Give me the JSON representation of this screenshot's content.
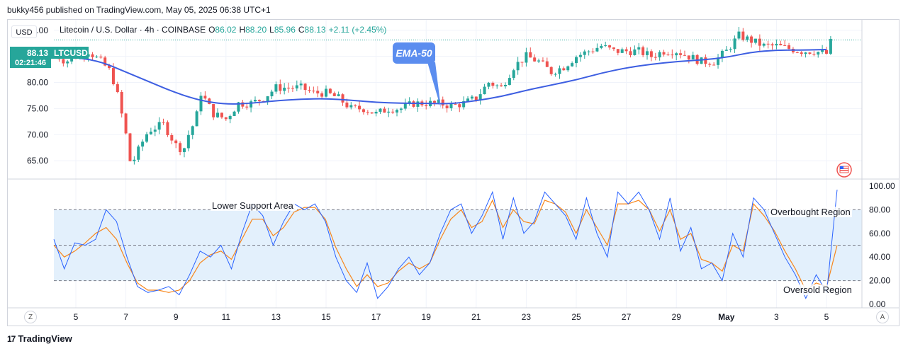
{
  "byline": "bukky456 published on TradingView.com, May 05, 2025 06:38 UTC+1",
  "footer_brand": "TradingView",
  "currency_button": "USD",
  "legend": {
    "symbol": "Litecoin / U.S. Dollar · 4h · COINBASE",
    "open_label": "O",
    "open": "86.02",
    "high_label": "H",
    "high": "88.20",
    "low_label": "L",
    "low": "85.96",
    "close_label": "C",
    "close": "88.13",
    "change": "+2.11 (+2.45%)"
  },
  "price_tag": {
    "price": "88.13",
    "ticker": "LTCUSD",
    "countdown": "02:21:46"
  },
  "ema_callout": "EMA-50",
  "annotations": {
    "lower_support": "Lower Support Area",
    "overbought": "Overbought Region",
    "oversold": "Oversold Region"
  },
  "corner_buttons": {
    "left": "Z",
    "right": "A"
  },
  "colors": {
    "up": "#26a69a",
    "down": "#ef5350",
    "ema": "#3d5ee1",
    "stoch_k": "#2962ff",
    "stoch_d": "#f7861c",
    "band": "#e3f0fc",
    "accent": "#26a69a"
  },
  "chart_data": [
    {
      "type": "candlestick",
      "title": "Litecoin / U.S. Dollar · 4h · COINBASE",
      "x_ticks": [
        "5",
        "7",
        "9",
        "11",
        "13",
        "15",
        "17",
        "19",
        "21",
        "23",
        "25",
        "27",
        "29",
        "May",
        "3",
        "5"
      ],
      "y_ticks": [
        "65.00",
        "70.00",
        "75.00",
        "80.00",
        "85.00",
        "90.00"
      ],
      "ylim": [
        61.5,
        92
      ],
      "last_price": 88.13,
      "close_path": [
        {
          "x": "Apr 4",
          "close": 86
        },
        {
          "x": "Apr 4.6",
          "close": 84
        },
        {
          "x": "Apr 5",
          "close": 85
        },
        {
          "x": "Apr 5.5",
          "close": 86
        },
        {
          "x": "Apr 6",
          "close": 84
        },
        {
          "x": "Apr 6.4",
          "close": 82
        },
        {
          "x": "Apr 6.7",
          "close": 77
        },
        {
          "x": "Apr 7",
          "close": 70
        },
        {
          "x": "Apr 7.2",
          "close": 64
        },
        {
          "x": "Apr 7.5",
          "close": 67
        },
        {
          "x": "Apr 7.8",
          "close": 70
        },
        {
          "x": "Apr 8",
          "close": 71
        },
        {
          "x": "Apr 8.5",
          "close": 72
        },
        {
          "x": "Apr 9",
          "close": 68
        },
        {
          "x": "Apr 9.3",
          "close": 67
        },
        {
          "x": "Apr 9.5",
          "close": 70
        },
        {
          "x": "Apr 9.8",
          "close": 73
        },
        {
          "x": "Apr 10",
          "close": 78
        },
        {
          "x": "Apr 10.5",
          "close": 74
        },
        {
          "x": "Apr 11",
          "close": 73
        },
        {
          "x": "Apr 11.5",
          "close": 76
        },
        {
          "x": "Apr 12",
          "close": 76
        },
        {
          "x": "Apr 12.5",
          "close": 77
        },
        {
          "x": "Apr 13",
          "close": 79
        },
        {
          "x": "Apr 13.5",
          "close": 79
        },
        {
          "x": "Apr 14",
          "close": 79
        },
        {
          "x": "Apr 14.5",
          "close": 78
        },
        {
          "x": "Apr 15",
          "close": 78
        },
        {
          "x": "Apr 15.5",
          "close": 77
        },
        {
          "x": "Apr 16",
          "close": 75
        },
        {
          "x": "Apr 16.5",
          "close": 75
        },
        {
          "x": "Apr 17",
          "close": 74
        },
        {
          "x": "Apr 17.5",
          "close": 75
        },
        {
          "x": "Apr 18",
          "close": 75
        },
        {
          "x": "Apr 18.5",
          "close": 76
        },
        {
          "x": "Apr 19",
          "close": 76
        },
        {
          "x": "Apr 19.5",
          "close": 76
        },
        {
          "x": "Apr 20",
          "close": 75.5
        },
        {
          "x": "Apr 20.5",
          "close": 76
        },
        {
          "x": "Apr 21",
          "close": 77
        },
        {
          "x": "Apr 21.5",
          "close": 80
        },
        {
          "x": "Apr 22",
          "close": 79
        },
        {
          "x": "Apr 22.5",
          "close": 83
        },
        {
          "x": "Apr 23",
          "close": 85
        },
        {
          "x": "Apr 23.5",
          "close": 84
        },
        {
          "x": "Apr 24",
          "close": 82
        },
        {
          "x": "Apr 24.5",
          "close": 83
        },
        {
          "x": "Apr 25",
          "close": 85
        },
        {
          "x": "Apr 25.5",
          "close": 86
        },
        {
          "x": "Apr 26",
          "close": 87
        },
        {
          "x": "Apr 26.5",
          "close": 86
        },
        {
          "x": "Apr 27",
          "close": 86
        },
        {
          "x": "Apr 27.5",
          "close": 86
        },
        {
          "x": "Apr 28",
          "close": 85
        },
        {
          "x": "Apr 28.5",
          "close": 86
        },
        {
          "x": "Apr 29",
          "close": 86
        },
        {
          "x": "Apr 29.5",
          "close": 85
        },
        {
          "x": "Apr 30",
          "close": 84
        },
        {
          "x": "Apr 30.5",
          "close": 84
        },
        {
          "x": "May 1",
          "close": 86
        },
        {
          "x": "May 1.5",
          "close": 89
        },
        {
          "x": "May 2",
          "close": 88
        },
        {
          "x": "May 2.5",
          "close": 87
        },
        {
          "x": "May 3",
          "close": 87
        },
        {
          "x": "May 3.5",
          "close": 86.5
        },
        {
          "x": "May 4",
          "close": 86
        },
        {
          "x": "May 4.5",
          "close": 86
        },
        {
          "x": "May 5",
          "close": 85.5
        },
        {
          "x": "May 5.2",
          "close": 88.13
        }
      ],
      "ema_50": [
        {
          "x": "Apr 4",
          "value": 85
        },
        {
          "x": "Apr 5",
          "value": 84.8
        },
        {
          "x": "Apr 6",
          "value": 84
        },
        {
          "x": "Apr 7",
          "value": 82
        },
        {
          "x": "Apr 8",
          "value": 80
        },
        {
          "x": "Apr 9",
          "value": 78
        },
        {
          "x": "Apr 10",
          "value": 76.5
        },
        {
          "x": "Apr 11",
          "value": 75.8
        },
        {
          "x": "Apr 12",
          "value": 76
        },
        {
          "x": "Apr 13",
          "value": 76.5
        },
        {
          "x": "Apr 14",
          "value": 76.8
        },
        {
          "x": "Apr 15",
          "value": 76.9
        },
        {
          "x": "Apr 16",
          "value": 76.6
        },
        {
          "x": "Apr 17",
          "value": 76.2
        },
        {
          "x": "Apr 18",
          "value": 76
        },
        {
          "x": "Apr 19",
          "value": 76
        },
        {
          "x": "Apr 20",
          "value": 75.9
        },
        {
          "x": "Apr 21",
          "value": 76.5
        },
        {
          "x": "Apr 22",
          "value": 77.3
        },
        {
          "x": "Apr 23",
          "value": 78.5
        },
        {
          "x": "Apr 24",
          "value": 79.5
        },
        {
          "x": "Apr 25",
          "value": 80.5
        },
        {
          "x": "Apr 26",
          "value": 81.8
        },
        {
          "x": "Apr 27",
          "value": 82.8
        },
        {
          "x": "Apr 28",
          "value": 83.5
        },
        {
          "x": "Apr 29",
          "value": 84
        },
        {
          "x": "Apr 30",
          "value": 84.3
        },
        {
          "x": "May 1",
          "value": 84.8
        },
        {
          "x": "May 2",
          "value": 85.8
        },
        {
          "x": "May 3",
          "value": 86.2
        },
        {
          "x": "May 4",
          "value": 86.2
        },
        {
          "x": "May 5",
          "value": 86.3
        }
      ]
    },
    {
      "type": "line",
      "title": "",
      "y_ticks": [
        "0.00",
        "20.00",
        "40.00",
        "60.00",
        "80.00",
        "100.00"
      ],
      "ylim": [
        -3,
        103
      ],
      "band": [
        20,
        80
      ],
      "midline": 50,
      "series": [
        {
          "values": [
            55,
            30,
            52,
            50,
            55,
            80,
            70,
            40,
            15,
            10,
            12,
            15,
            8,
            25,
            45,
            40,
            50,
            30,
            60,
            85,
            75,
            50,
            70,
            85,
            80,
            85,
            70,
            40,
            20,
            10,
            35,
            5,
            15,
            30,
            40,
            25,
            35,
            60,
            80,
            85,
            60,
            75,
            95,
            55,
            90,
            60,
            70,
            95,
            85,
            75,
            55,
            90,
            60,
            40,
            95,
            85,
            95,
            80,
            55,
            90,
            45,
            65,
            30,
            35,
            20,
            60,
            40,
            90,
            80,
            60,
            40,
            25,
            5,
            25,
            10,
            97
          ]
        },
        {
          "values": [
            50,
            40,
            45,
            52,
            60,
            65,
            55,
            35,
            18,
            12,
            12,
            10,
            12,
            20,
            35,
            42,
            45,
            38,
            55,
            72,
            72,
            58,
            65,
            78,
            82,
            82,
            72,
            48,
            30,
            15,
            25,
            15,
            18,
            28,
            35,
            30,
            35,
            55,
            72,
            80,
            65,
            70,
            88,
            65,
            80,
            70,
            68,
            88,
            85,
            78,
            60,
            80,
            65,
            50,
            85,
            85,
            88,
            80,
            62,
            80,
            55,
            60,
            38,
            35,
            28,
            50,
            45,
            85,
            75,
            62,
            45,
            30,
            12,
            18,
            15,
            50
          ]
        }
      ]
    }
  ]
}
